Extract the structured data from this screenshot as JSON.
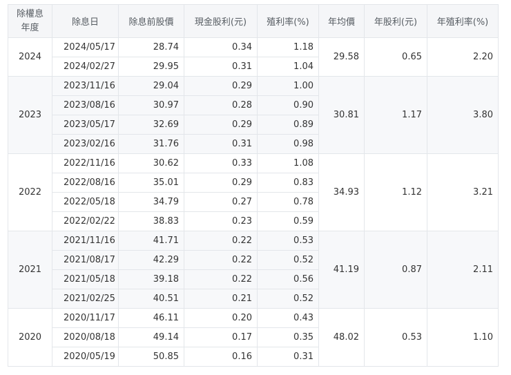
{
  "table": {
    "headers": {
      "year_line1": "除權息",
      "year_line2": "年度",
      "date": "除息日",
      "pre_price": "除息前股價",
      "cash_dividend": "現金股利(元)",
      "yield": "殖利率(%)",
      "avg_price": "年均價",
      "annual_dividend": "年股利(元)",
      "annual_yield": "年殖利率(%)"
    },
    "groups": [
      {
        "year": "2024",
        "avg_price": "29.58",
        "annual_dividend": "0.65",
        "annual_yield": "2.20",
        "rows": [
          {
            "date": "2024/05/17",
            "pre_price": "28.74",
            "cash": "0.34",
            "yield": "1.18"
          },
          {
            "date": "2024/02/27",
            "pre_price": "29.95",
            "cash": "0.31",
            "yield": "1.04"
          }
        ]
      },
      {
        "year": "2023",
        "avg_price": "30.81",
        "annual_dividend": "1.17",
        "annual_yield": "3.80",
        "rows": [
          {
            "date": "2023/11/16",
            "pre_price": "29.04",
            "cash": "0.29",
            "yield": "1.00"
          },
          {
            "date": "2023/08/16",
            "pre_price": "30.97",
            "cash": "0.28",
            "yield": "0.90"
          },
          {
            "date": "2023/05/17",
            "pre_price": "32.69",
            "cash": "0.29",
            "yield": "0.89"
          },
          {
            "date": "2023/02/16",
            "pre_price": "31.76",
            "cash": "0.31",
            "yield": "0.98"
          }
        ]
      },
      {
        "year": "2022",
        "avg_price": "34.93",
        "annual_dividend": "1.12",
        "annual_yield": "3.21",
        "rows": [
          {
            "date": "2022/11/16",
            "pre_price": "30.62",
            "cash": "0.33",
            "yield": "1.08"
          },
          {
            "date": "2022/08/16",
            "pre_price": "35.01",
            "cash": "0.29",
            "yield": "0.83"
          },
          {
            "date": "2022/05/18",
            "pre_price": "34.79",
            "cash": "0.27",
            "yield": "0.78"
          },
          {
            "date": "2022/02/22",
            "pre_price": "38.83",
            "cash": "0.23",
            "yield": "0.59"
          }
        ]
      },
      {
        "year": "2021",
        "avg_price": "41.19",
        "annual_dividend": "0.87",
        "annual_yield": "2.11",
        "rows": [
          {
            "date": "2021/11/16",
            "pre_price": "41.71",
            "cash": "0.22",
            "yield": "0.53"
          },
          {
            "date": "2021/08/17",
            "pre_price": "42.29",
            "cash": "0.22",
            "yield": "0.52"
          },
          {
            "date": "2021/05/18",
            "pre_price": "39.18",
            "cash": "0.22",
            "yield": "0.56"
          },
          {
            "date": "2021/02/25",
            "pre_price": "40.51",
            "cash": "0.21",
            "yield": "0.52"
          }
        ]
      },
      {
        "year": "2020",
        "avg_price": "48.02",
        "annual_dividend": "0.53",
        "annual_yield": "1.10",
        "rows": [
          {
            "date": "2020/11/17",
            "pre_price": "46.11",
            "cash": "0.20",
            "yield": "0.43"
          },
          {
            "date": "2020/08/18",
            "pre_price": "49.14",
            "cash": "0.17",
            "yield": "0.35"
          },
          {
            "date": "2020/05/19",
            "pre_price": "50.85",
            "cash": "0.16",
            "yield": "0.31"
          }
        ]
      }
    ]
  }
}
